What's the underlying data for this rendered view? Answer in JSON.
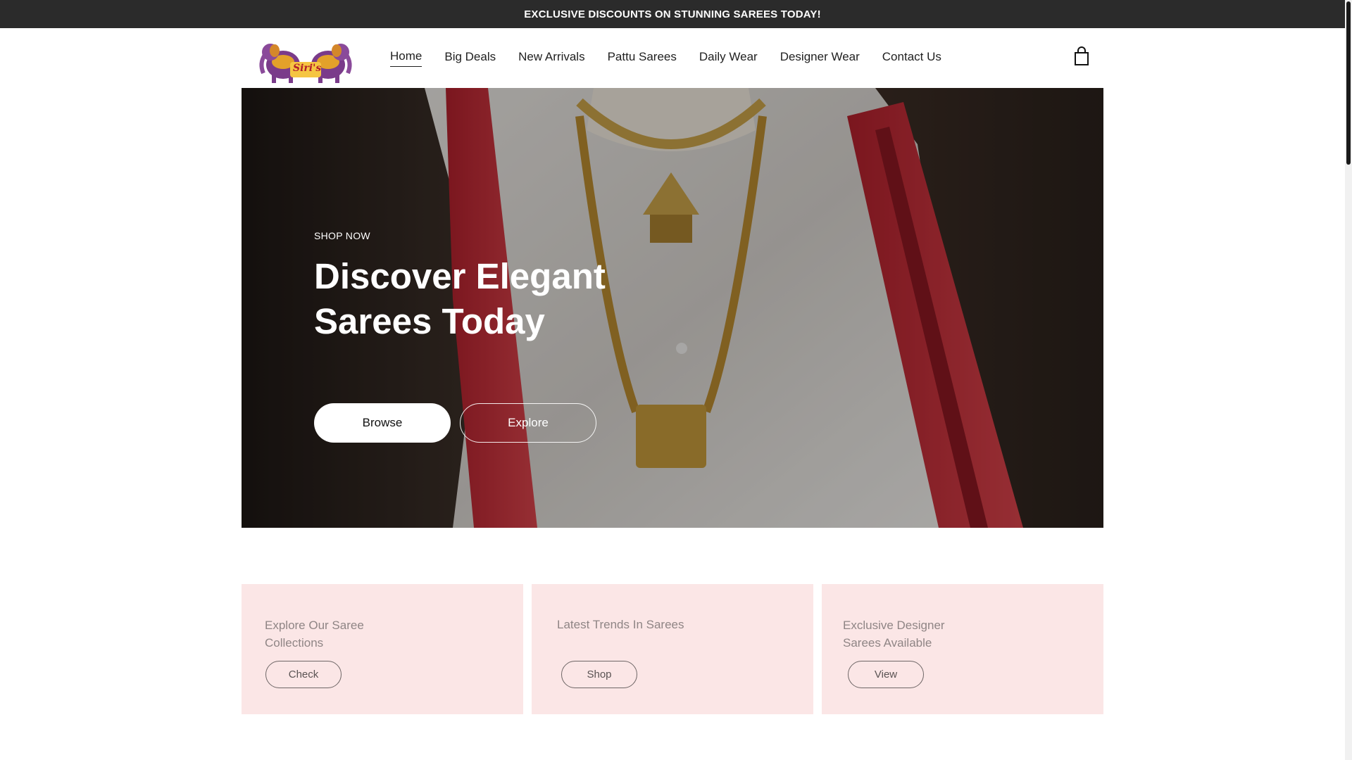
{
  "announcement": "EXCLUSIVE DISCOUNTS ON STUNNING SAREES TODAY!",
  "brand": {
    "logo_text": "Siri's"
  },
  "nav": {
    "items": [
      "Home",
      "Big Deals",
      "New Arrivals",
      "Pattu Sarees",
      "Daily Wear",
      "Designer Wear",
      "Contact Us"
    ],
    "active": "Home"
  },
  "hero": {
    "eyebrow": "SHOP NOW",
    "title": "Discover Elegant Sarees Today",
    "primary_button": "Browse",
    "secondary_button": "Explore"
  },
  "cards": [
    {
      "title": "Explore Our Saree Collections",
      "button": "Check"
    },
    {
      "title": "Latest Trends In Sarees",
      "button": "Shop"
    },
    {
      "title": "Exclusive Designer Sarees Available",
      "button": "View"
    }
  ],
  "colors": {
    "announcement_bg": "#2b2b2b",
    "card_bg": "#fbe6e6",
    "accent_red": "#c8323c",
    "gold": "#c9a34a"
  },
  "icons": {
    "cart": "shopping-bag-icon"
  }
}
